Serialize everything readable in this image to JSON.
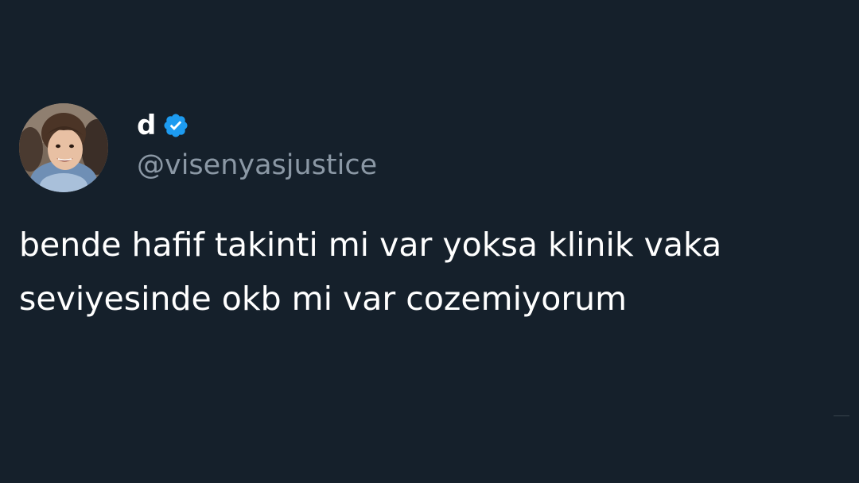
{
  "tweet": {
    "display_name": "d",
    "handle": "@visenyasjustice",
    "text_lines": [
      "bende hafif takinti mi var yoksa klinik vaka",
      "seviyesinde okb mi var cozemiyorum"
    ]
  },
  "icons": {
    "avatar": "profile-photo-child",
    "verified": "verified-badge-icon"
  },
  "colors": {
    "background": "#15202b",
    "text": "#ffffff",
    "secondary_text": "#8b98a5",
    "verified": "#1d9bf0"
  }
}
